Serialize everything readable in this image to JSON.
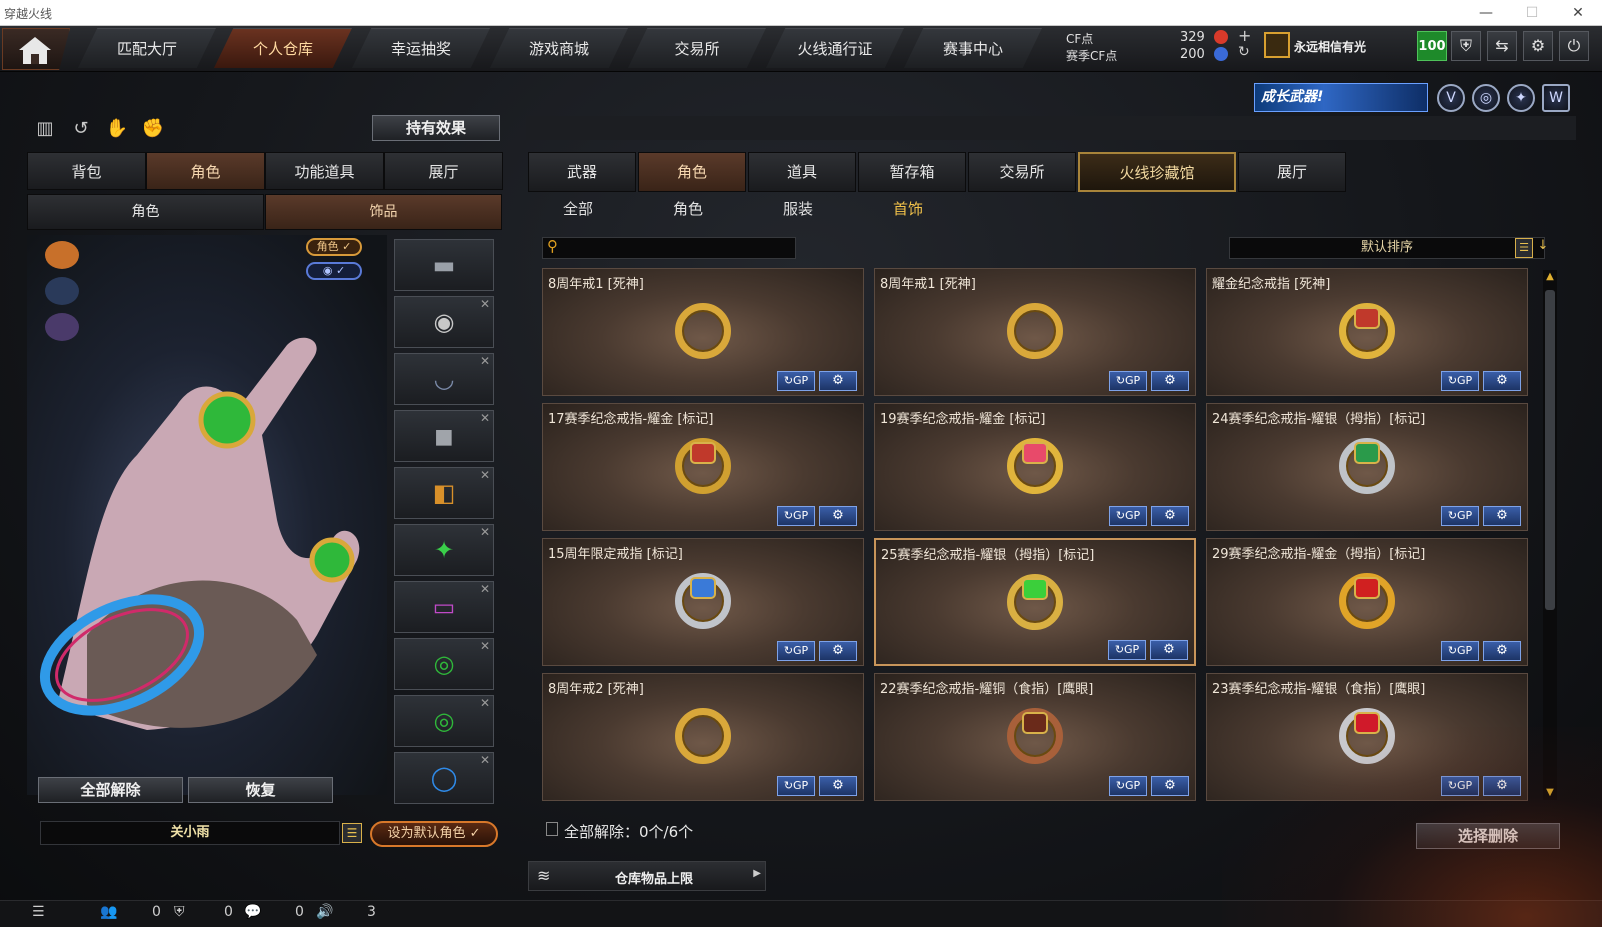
{
  "window": {
    "title": "穿越火线",
    "minimize": "—",
    "maximize": "☐",
    "close": "✕"
  },
  "nav": {
    "home_icon": "house-icon",
    "tabs": [
      "匹配大厅",
      "个人仓库",
      "幸运抽奖",
      "游戏商城",
      "交易所",
      "火线通行证",
      "赛事中心"
    ],
    "active_index": 1
  },
  "currency": {
    "cf_label": "CF点",
    "cf_value": "329",
    "season_label": "赛季CF点",
    "season_value": "200",
    "add": "+",
    "refresh": "↻"
  },
  "user": {
    "name": "永远相信有光",
    "level": "100"
  },
  "banner_text": "成长武器!",
  "left": {
    "effects_button": "持有效果",
    "tabs": [
      "背包",
      "角色",
      "功能道具",
      "展厅"
    ],
    "active_tab": 1,
    "subtabs": [
      "角色",
      "饰品"
    ],
    "active_subtab": 1,
    "role_chip": "角色 ✓",
    "eye_chip": "◉ ✓",
    "unequip_all": "全部解除",
    "restore": "恢复",
    "role_name": "关小雨",
    "set_default": "设为默认角色 ✓"
  },
  "right": {
    "tabs": [
      "武器",
      "角色",
      "道具",
      "暂存箱",
      "交易所",
      "火线珍藏馆",
      "展厅"
    ],
    "active_tab": 1,
    "gold_tab": 5,
    "categories": [
      "全部",
      "角色",
      "服装",
      "首饰"
    ],
    "active_category": 3,
    "search_placeholder": "",
    "sort_label": "默认排序",
    "status_label": "全部解除：0个/6个",
    "delete_button": "选择删除",
    "limit_label": "仓库物品上限"
  },
  "items": [
    {
      "name": "8周年戒1 [死神]",
      "gem": "",
      "ring": "#d9a83a"
    },
    {
      "name": "8周年戒1 [死神]",
      "gem": "",
      "ring": "#d9a83a"
    },
    {
      "name": "耀金纪念戒指 [死神]",
      "gem": "#c0392b",
      "ring": "#e0b43c"
    },
    {
      "name": "17赛季纪念戒指-耀金 [标记]",
      "gem": "#c0392b",
      "ring": "#d0a030"
    },
    {
      "name": "19赛季纪念戒指-耀金 [标记]",
      "gem": "#e84a6a",
      "ring": "#e0b43c"
    },
    {
      "name": "24赛季纪念戒指-耀银（拇指）[标记]",
      "gem": "#2a9a4a",
      "ring": "#bfc3c8"
    },
    {
      "name": "15周年限定戒指 [标记]",
      "gem": "#3a7ad8",
      "ring": "#c0c4ca"
    },
    {
      "name": "25赛季纪念戒指-耀银（拇指）[标记]",
      "gem": "#3bcf3b",
      "ring": "#d9b042"
    },
    {
      "name": "29赛季纪念戒指-耀金（拇指）[标记]",
      "gem": "#d02020",
      "ring": "#e0a428"
    },
    {
      "name": "8周年戒2 [死神]",
      "gem": "",
      "ring": "#d9a83a"
    },
    {
      "name": "22赛季纪念戒指-耀铜（食指）[鹰眼]",
      "gem": "#6a2a1a",
      "ring": "#a8603a"
    },
    {
      "name": "23赛季纪念戒指-耀银（食指）[鹰眼]",
      "gem": "#d01a2a",
      "ring": "#c8c8cc"
    }
  ],
  "selected_item": 7,
  "bottom": {
    "count1": "0",
    "count2": "0",
    "count3": "0",
    "count4": "3"
  }
}
